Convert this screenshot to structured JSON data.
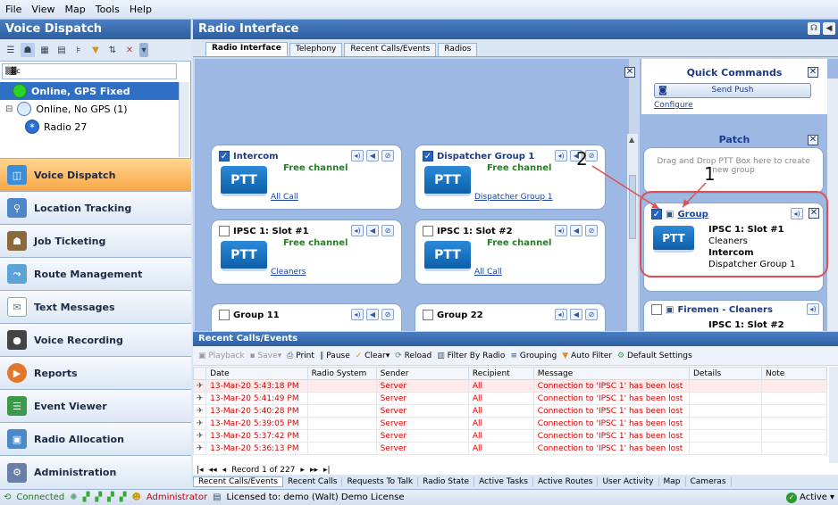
{
  "menu": [
    "File",
    "View",
    "Map",
    "Tools",
    "Help"
  ],
  "left": {
    "title": "Voice Dispatch",
    "search_value": "▒▓c",
    "tree": [
      {
        "label": "Online, GPS Fixed",
        "selected": true
      },
      {
        "label": "Online, No GPS (1)",
        "selected": false
      },
      {
        "label": "Radio 27",
        "selected": false
      }
    ],
    "nav": [
      {
        "label": "Voice Dispatch",
        "icon": "voice-dispatch-icon",
        "active": true
      },
      {
        "label": "Location Tracking",
        "icon": "location-icon"
      },
      {
        "label": "Job Ticketing",
        "icon": "job-icon"
      },
      {
        "label": "Route Management",
        "icon": "route-icon"
      },
      {
        "label": "Text Messages",
        "icon": "message-icon"
      },
      {
        "label": "Voice Recording",
        "icon": "recording-icon"
      },
      {
        "label": "Reports",
        "icon": "reports-icon"
      },
      {
        "label": "Event Viewer",
        "icon": "event-icon"
      },
      {
        "label": "Radio Allocation",
        "icon": "allocation-icon"
      },
      {
        "label": "Administration",
        "icon": "admin-icon"
      }
    ]
  },
  "radio": {
    "title": "Radio Interface",
    "tabs": [
      "Radio Interface",
      "Telephony",
      "Recent Calls/Events",
      "Radios"
    ],
    "ptt_label": "PTT",
    "boxes": [
      {
        "name": "Intercom",
        "checked": true,
        "status": "Free channel",
        "link": "All Call"
      },
      {
        "name": "Dispatcher Group 1",
        "checked": true,
        "status": "Free channel",
        "link": "Dispatcher Group 1"
      },
      {
        "name": "IPSC 1: Slot #1",
        "checked": false,
        "status": "Free channel",
        "link": "Cleaners"
      },
      {
        "name": "IPSC 1: Slot #2",
        "checked": false,
        "status": "Free channel",
        "link": "All Call"
      },
      {
        "name": "Group 11",
        "checked": false,
        "status": "",
        "link": ""
      },
      {
        "name": "Group 22",
        "checked": false,
        "status": "",
        "link": ""
      }
    ]
  },
  "quick": {
    "title": "Quick Commands",
    "send_push": "Send Push",
    "configure": "Configure"
  },
  "patch": {
    "title": "Patch",
    "hint": "Drag and Drop PTT Box here to create new group",
    "group": {
      "name": "Group",
      "line1": "IPSC 1: Slot #1",
      "line2": "Cleaners",
      "line3": "Intercom",
      "line4": "Dispatcher Group 1"
    },
    "firemen": {
      "name": "Firemen - Cleaners",
      "line1": "IPSC 1: Slot #2"
    }
  },
  "annotations": {
    "one": "1",
    "two": "2"
  },
  "recent": {
    "title": "Recent Calls/Events",
    "toolbar": [
      "Playback",
      "Save",
      "Print",
      "Pause",
      "Clear",
      "Reload",
      "Filter By Radio",
      "Grouping",
      "Auto Filter",
      "Default Settings"
    ],
    "columns": [
      "Date",
      "Radio System",
      "Sender",
      "Recipient",
      "Message",
      "Details",
      "Note"
    ],
    "rows": [
      {
        "date": "13-Mar-20 5:43:18 PM",
        "system": "",
        "sender": "Server",
        "recipient": "All",
        "message": "Connection to 'IPSC 1' has been lost"
      },
      {
        "date": "13-Mar-20 5:41:49 PM",
        "system": "",
        "sender": "Server",
        "recipient": "All",
        "message": "Connection to 'IPSC 1' has been lost"
      },
      {
        "date": "13-Mar-20 5:40:28 PM",
        "system": "",
        "sender": "Server",
        "recipient": "All",
        "message": "Connection to 'IPSC 1' has been lost"
      },
      {
        "date": "13-Mar-20 5:39:05 PM",
        "system": "",
        "sender": "Server",
        "recipient": "All",
        "message": "Connection to 'IPSC 1' has been lost"
      },
      {
        "date": "13-Mar-20 5:37:42 PM",
        "system": "",
        "sender": "Server",
        "recipient": "All",
        "message": "Connection to 'IPSC 1' has been lost"
      },
      {
        "date": "13-Mar-20 5:36:13 PM",
        "system": "",
        "sender": "Server",
        "recipient": "All",
        "message": "Connection to 'IPSC 1' has been lost"
      }
    ],
    "record": "Record 1 of 227",
    "bottom_tabs": [
      "Recent Calls/Events",
      "Recent Calls",
      "Requests To Talk",
      "Radio State",
      "Active Tasks",
      "Active Routes",
      "User Activity",
      "Map",
      "Cameras"
    ]
  },
  "status": {
    "connected": "Connected",
    "user": "Administrator",
    "license": "Licensed to: demo (Walt) Demo License",
    "active": "Active"
  },
  "colors": {
    "accent": "#2d5e9f",
    "active_nav": "#f9a747",
    "highlight_ring": "#e05050",
    "error_text": "#dd0000"
  }
}
